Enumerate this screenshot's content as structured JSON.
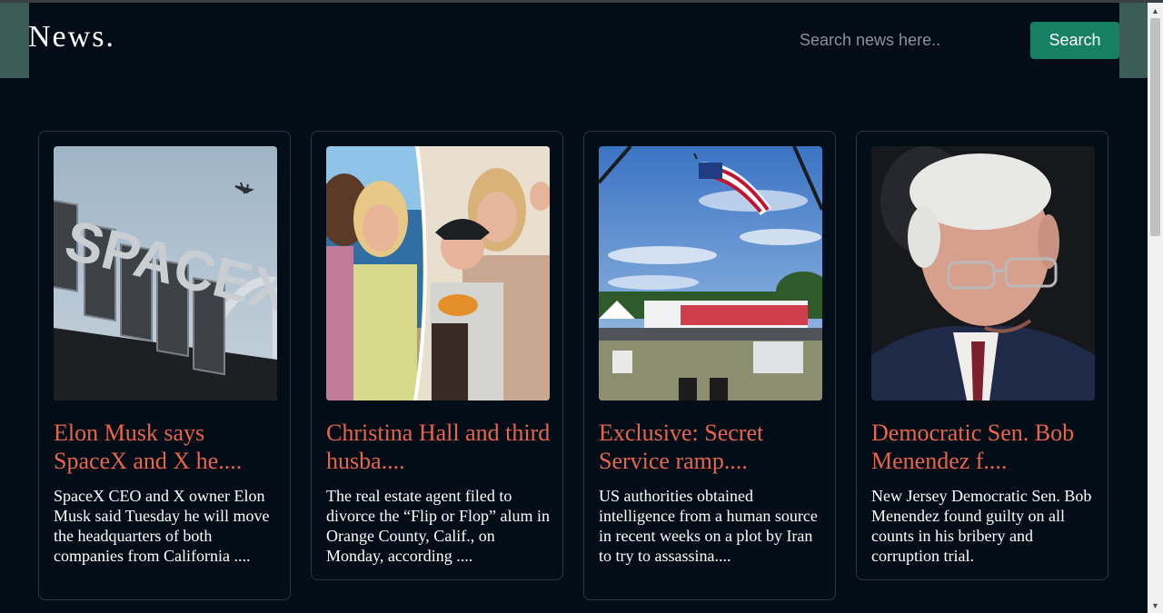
{
  "header": {
    "brand": "News.",
    "search_placeholder": "Search news here..",
    "search_button": "Search"
  },
  "articles": [
    {
      "title": "Elon Musk says SpaceX and X he....",
      "description": "SpaceX CEO and X owner Elon Musk said Tuesday he will move the headquarters of both companies from California ....",
      "image_sign_text": "SPACEX"
    },
    {
      "title": "Christina Hall and third husba....",
      "description": "The real estate agent filed to divorce the “Flip or Flop” alum in Orange County, Calif., on Monday, according ...."
    },
    {
      "title": "Exclusive: Secret Service ramp....",
      "description": "US authorities obtained intelligence from a human source in recent weeks on a plot by Iran to try to assassina...."
    },
    {
      "title": "Democratic Sen. Bob Menendez f....",
      "description": "New Jersey Democratic Sen. Bob Menendez found guilty on all counts in his bribery and corruption trial."
    }
  ],
  "colors": {
    "background": "#020d18",
    "accent": "#168064",
    "title": "#e8654a"
  }
}
